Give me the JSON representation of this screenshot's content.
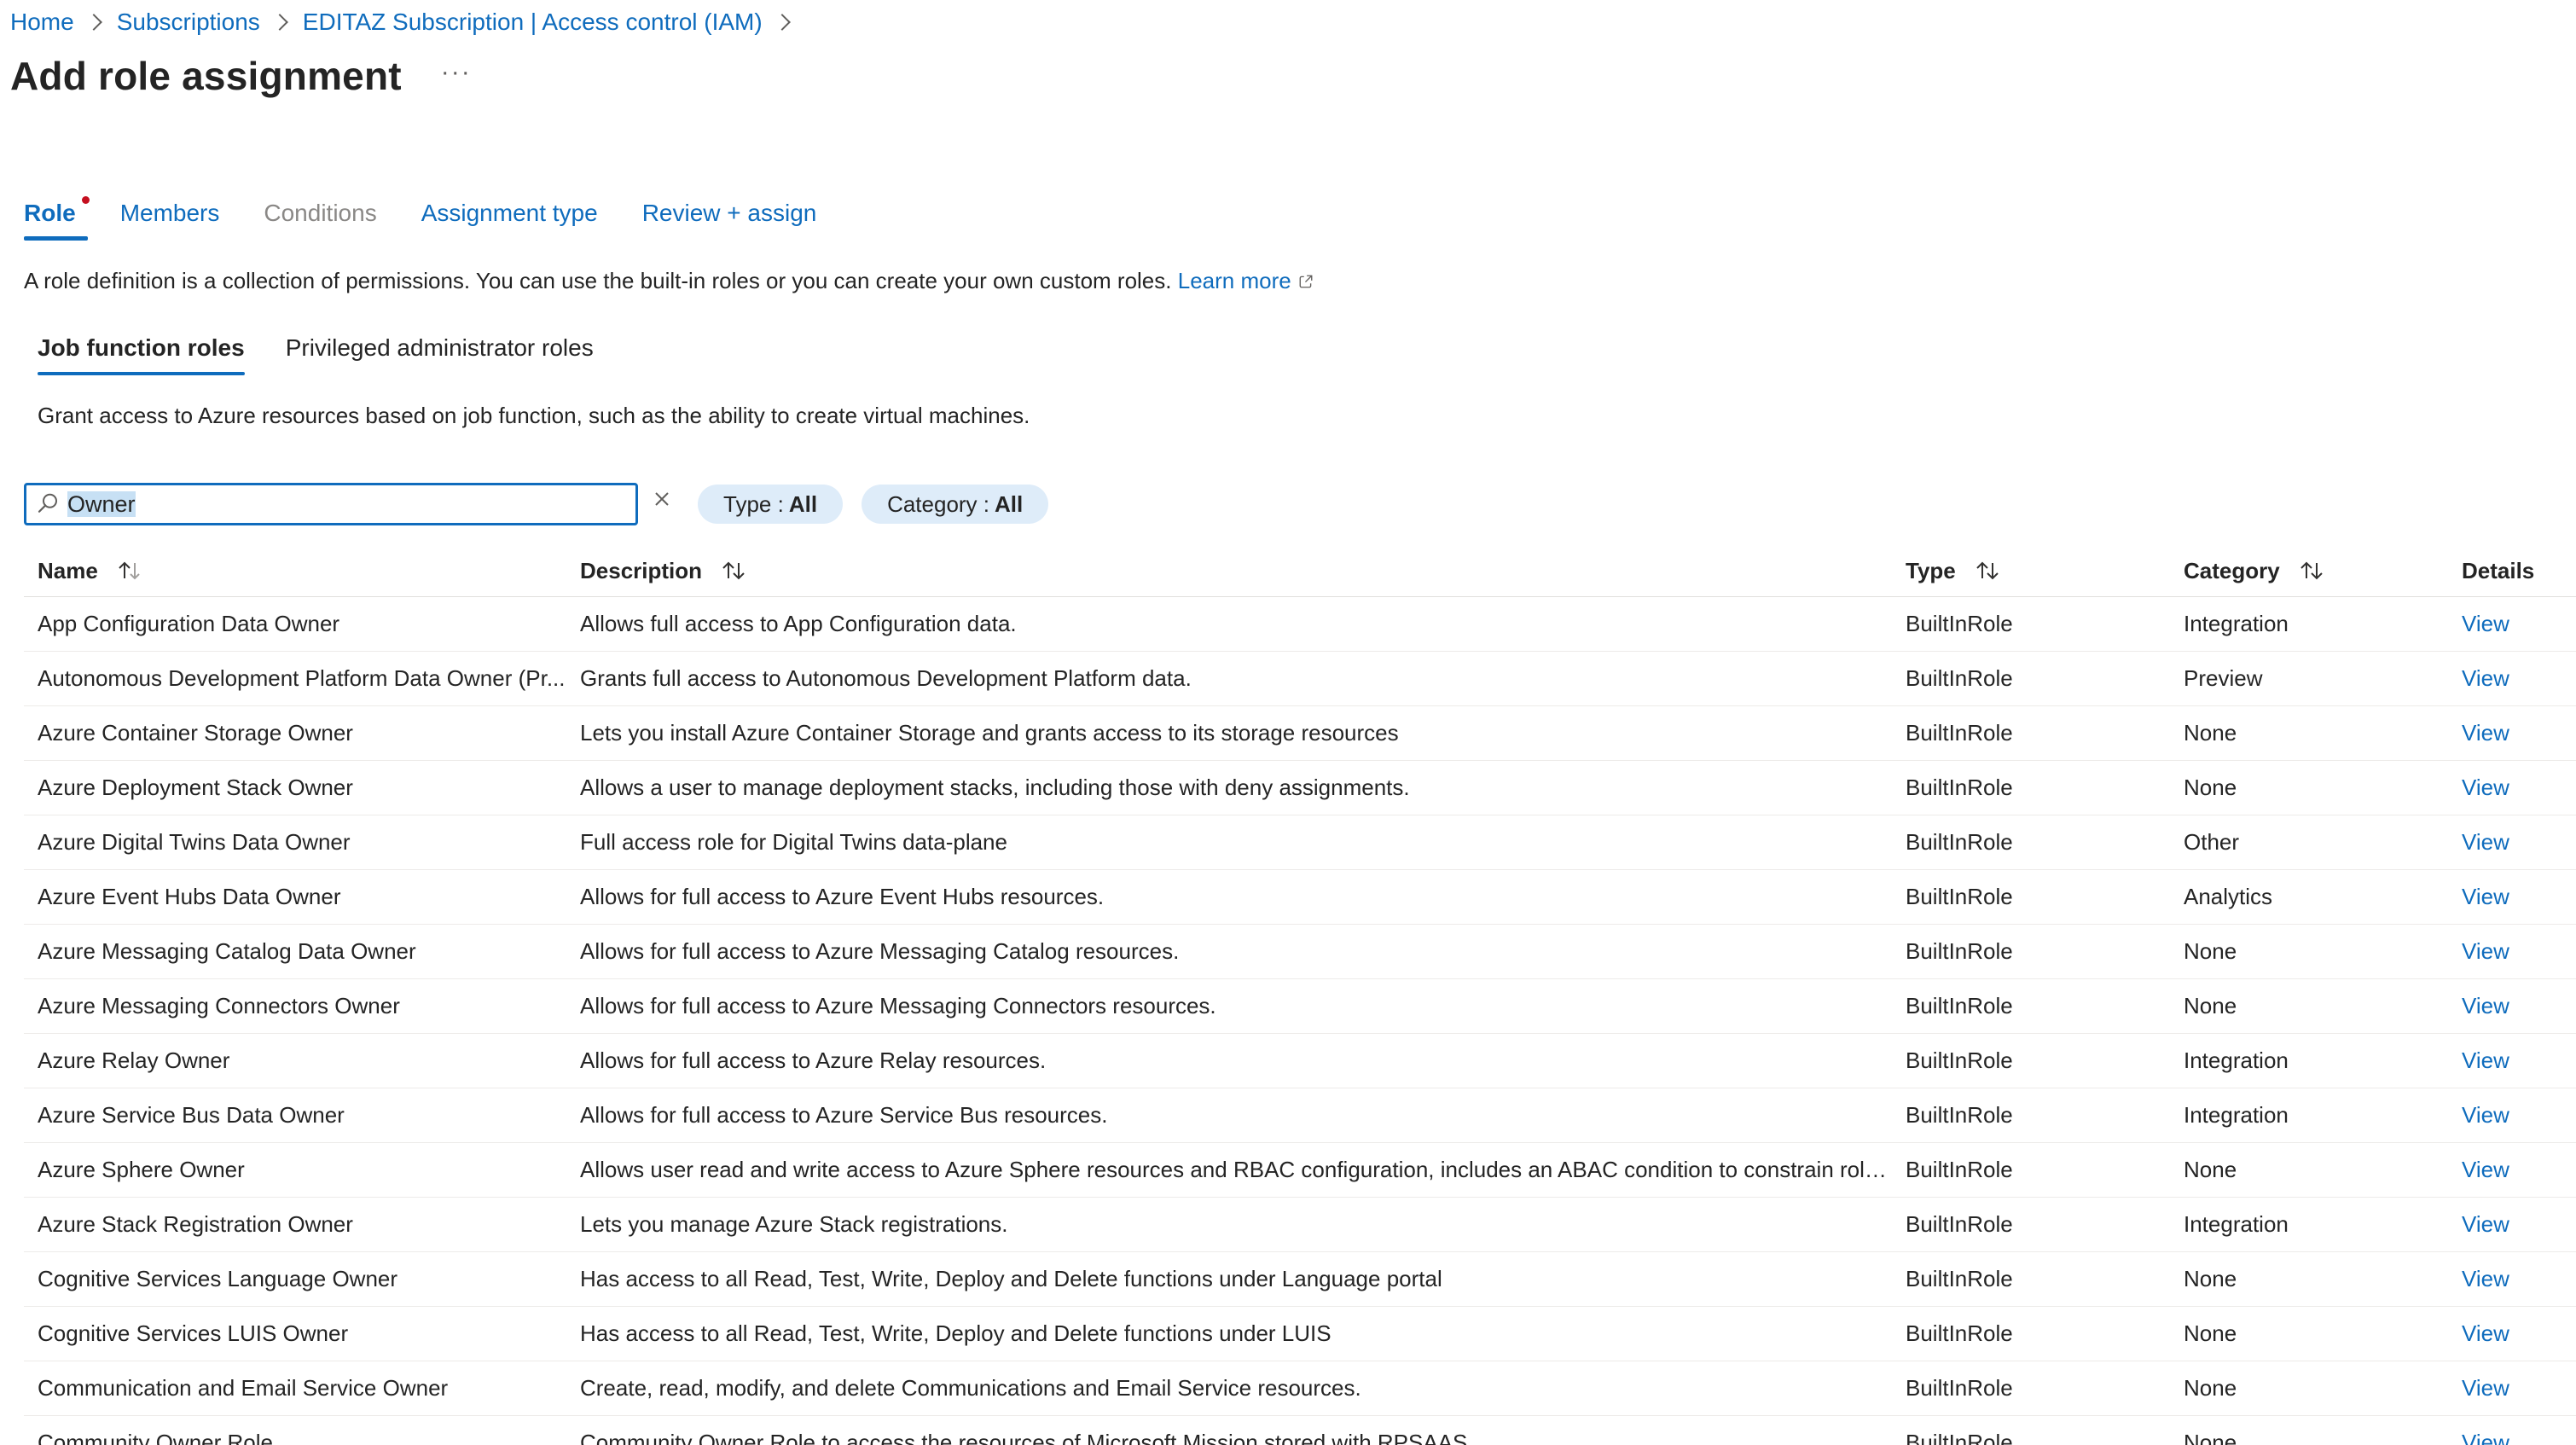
{
  "breadcrumb": [
    "Home",
    "Subscriptions",
    "EDITAZ Subscription | Access control (IAM)"
  ],
  "page_title": "Add role assignment",
  "more_label": "···",
  "wizard_tabs": [
    {
      "label": "Role",
      "state": "active"
    },
    {
      "label": "Members",
      "state": "normal"
    },
    {
      "label": "Conditions",
      "state": "disabled"
    },
    {
      "label": "Assignment type",
      "state": "normal"
    },
    {
      "label": "Review + assign",
      "state": "normal"
    }
  ],
  "intro": {
    "text": "A role definition is a collection of permissions. You can use the built-in roles or you can create your own custom roles.",
    "link": "Learn more"
  },
  "sub_tabs": [
    {
      "label": "Job function roles",
      "active": true
    },
    {
      "label": "Privileged administrator roles",
      "active": false
    }
  ],
  "sub_description": "Grant access to Azure resources based on job function, such as the ability to create virtual machines.",
  "search": {
    "value": "Owner"
  },
  "filters": [
    {
      "label": "Type :",
      "value": "All"
    },
    {
      "label": "Category :",
      "value": "All"
    }
  ],
  "columns": {
    "name": "Name",
    "description": "Description",
    "type": "Type",
    "category": "Category",
    "details": "Details"
  },
  "rows": [
    {
      "name": "App Configuration Data Owner",
      "description": "Allows full access to App Configuration data.",
      "type": "BuiltInRole",
      "category": "Integration",
      "details": "View"
    },
    {
      "name": "Autonomous Development Platform Data Owner (Pr...",
      "description": "Grants full access to Autonomous Development Platform data.",
      "type": "BuiltInRole",
      "category": "Preview",
      "details": "View"
    },
    {
      "name": "Azure Container Storage Owner",
      "description": "Lets you install Azure Container Storage and grants access to its storage resources",
      "type": "BuiltInRole",
      "category": "None",
      "details": "View"
    },
    {
      "name": "Azure Deployment Stack Owner",
      "description": "Allows a user to manage deployment stacks, including those with deny assignments.",
      "type": "BuiltInRole",
      "category": "None",
      "details": "View"
    },
    {
      "name": "Azure Digital Twins Data Owner",
      "description": "Full access role for Digital Twins data-plane",
      "type": "BuiltInRole",
      "category": "Other",
      "details": "View"
    },
    {
      "name": "Azure Event Hubs Data Owner",
      "description": "Allows for full access to Azure Event Hubs resources.",
      "type": "BuiltInRole",
      "category": "Analytics",
      "details": "View"
    },
    {
      "name": "Azure Messaging Catalog Data Owner",
      "description": "Allows for full access to Azure Messaging Catalog resources.",
      "type": "BuiltInRole",
      "category": "None",
      "details": "View"
    },
    {
      "name": "Azure Messaging Connectors Owner",
      "description": "Allows for full access to Azure Messaging Connectors resources.",
      "type": "BuiltInRole",
      "category": "None",
      "details": "View"
    },
    {
      "name": "Azure Relay Owner",
      "description": "Allows for full access to Azure Relay resources.",
      "type": "BuiltInRole",
      "category": "Integration",
      "details": "View"
    },
    {
      "name": "Azure Service Bus Data Owner",
      "description": "Allows for full access to Azure Service Bus resources.",
      "type": "BuiltInRole",
      "category": "Integration",
      "details": "View"
    },
    {
      "name": "Azure Sphere Owner",
      "description": "Allows user read and write access to Azure Sphere resources and RBAC configuration, includes an ABAC condition to constrain role as...",
      "type": "BuiltInRole",
      "category": "None",
      "details": "View"
    },
    {
      "name": "Azure Stack Registration Owner",
      "description": "Lets you manage Azure Stack registrations.",
      "type": "BuiltInRole",
      "category": "Integration",
      "details": "View"
    },
    {
      "name": "Cognitive Services Language Owner",
      "description": "Has access to all Read, Test, Write, Deploy and Delete functions under Language portal",
      "type": "BuiltInRole",
      "category": "None",
      "details": "View"
    },
    {
      "name": "Cognitive Services LUIS Owner",
      "description": "Has access to all Read, Test, Write, Deploy and Delete functions under LUIS",
      "type": "BuiltInRole",
      "category": "None",
      "details": "View"
    },
    {
      "name": "Communication and Email Service Owner",
      "description": "Create, read, modify, and delete Communications and Email Service resources.",
      "type": "BuiltInRole",
      "category": "None",
      "details": "View"
    },
    {
      "name": "Community Owner Role",
      "description": "Community Owner Role to access the resources of Microsoft.Mission stored with RPSAAS",
      "type": "BuiltInRole",
      "category": "None",
      "details": "View"
    }
  ],
  "colors": {
    "accent": "#0f6cbd",
    "pill_bg": "#deecf9",
    "required_dot": "#c50f1f"
  }
}
